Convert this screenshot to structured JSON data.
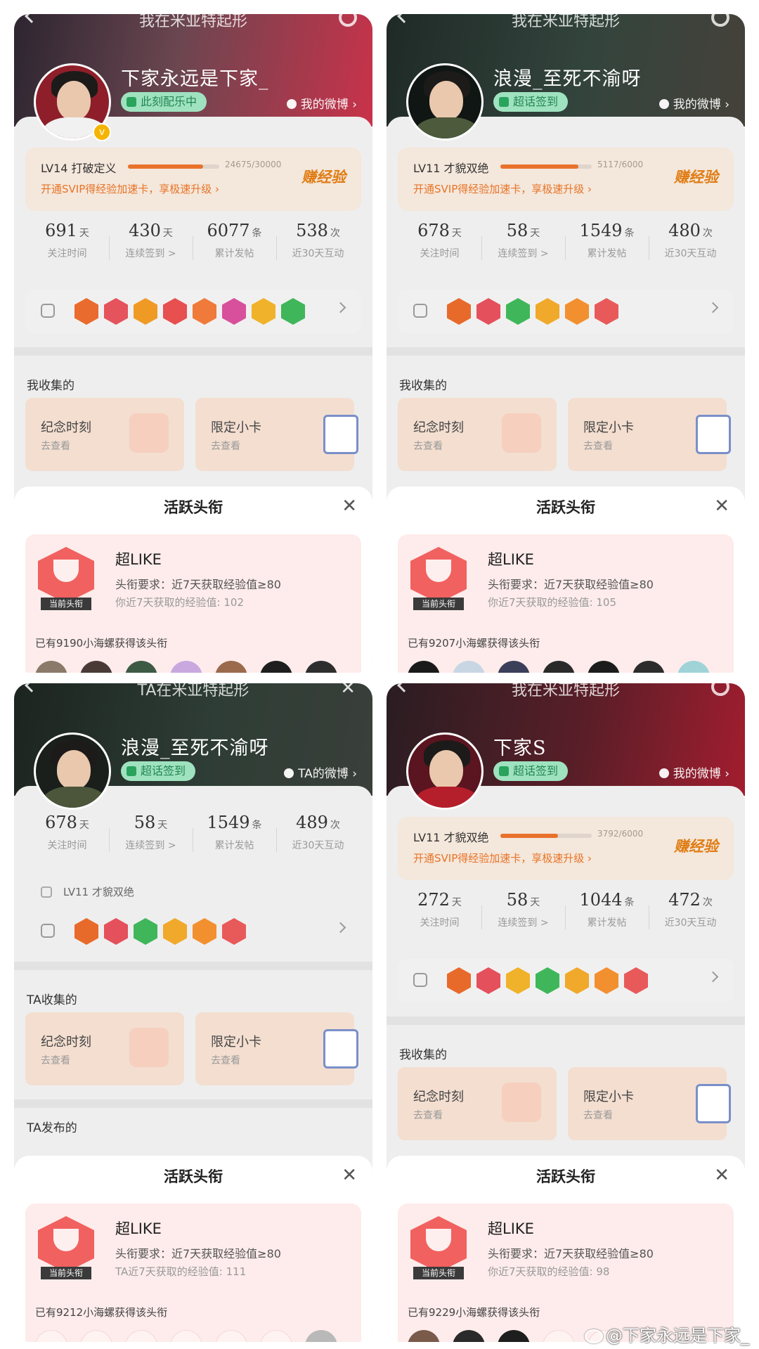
{
  "panels": [
    {
      "top_title": "我在米亚特起形",
      "nickname": "下家永远是下家_",
      "badge": "此刻配乐中",
      "weibo_link": "我的微博",
      "level": {
        "name": "LV14 打破定义",
        "progress_text": "24675/30000",
        "progress": 0.82,
        "promo": "开通SVIP得经验加速卡，享极速升级",
        "earn": "赚经验"
      },
      "stats": [
        {
          "num": "691",
          "unit": "天",
          "label": "关注时间"
        },
        {
          "num": "430",
          "unit": "天",
          "label": "连续签到 >"
        },
        {
          "num": "6077",
          "unit": "条",
          "label": "累计发帖"
        },
        {
          "num": "538",
          "unit": "次",
          "label": "近30天互动"
        }
      ],
      "collection_title": "我收集的",
      "tiles": [
        {
          "title": "纪念时刻",
          "sub": "去查看"
        },
        {
          "title": "限定小卡",
          "sub": "去查看"
        }
      ],
      "sheet": {
        "title": "活跃头衔",
        "name": "超LIKE",
        "requirement": "头衔要求：近7天获取经验值≥80",
        "exp": "你近7天获取的经验值: 102",
        "ribbon": "当前头衔",
        "count": "已有9190小海螺获得该头衔"
      }
    },
    {
      "top_title": "我在米亚特起形",
      "nickname": "浪漫_至死不渝呀",
      "badge": "超话签到",
      "weibo_link": "我的微博",
      "level": {
        "name": "LV11 才貌双绝",
        "progress_text": "5117/6000",
        "progress": 0.85,
        "promo": "开通SVIP得经验加速卡，享极速升级",
        "earn": "赚经验"
      },
      "stats": [
        {
          "num": "678",
          "unit": "天",
          "label": "关注时间"
        },
        {
          "num": "58",
          "unit": "天",
          "label": "连续签到 >"
        },
        {
          "num": "1549",
          "unit": "条",
          "label": "累计发帖"
        },
        {
          "num": "480",
          "unit": "次",
          "label": "近30天互动"
        }
      ],
      "collection_title": "我收集的",
      "tiles": [
        {
          "title": "纪念时刻",
          "sub": "去查看"
        },
        {
          "title": "限定小卡",
          "sub": "去查看"
        }
      ],
      "sheet": {
        "title": "活跃头衔",
        "name": "超LIKE",
        "requirement": "头衔要求：近7天获取经验值≥80",
        "exp": "你近7天获取的经验值: 105",
        "ribbon": "当前头衔",
        "count": "已有9207小海螺获得该头衔"
      }
    },
    {
      "top_title": "TA在米亚特起形",
      "nickname": "浪漫_至死不渝呀",
      "badge": "超话签到",
      "weibo_link": "TA的微博",
      "level_inline": "LV11 才貌双绝",
      "stats": [
        {
          "num": "678",
          "unit": "天",
          "label": "关注时间"
        },
        {
          "num": "58",
          "unit": "天",
          "label": "连续签到 >"
        },
        {
          "num": "1549",
          "unit": "条",
          "label": "累计发帖"
        },
        {
          "num": "489",
          "unit": "次",
          "label": "近30天互动"
        }
      ],
      "collection_title": "TA收集的",
      "published_title": "TA发布的",
      "tiles": [
        {
          "title": "纪念时刻",
          "sub": "去查看"
        },
        {
          "title": "限定小卡",
          "sub": "去查看"
        }
      ],
      "sheet": {
        "title": "活跃头衔",
        "name": "超LIKE",
        "requirement": "头衔要求：近7天获取经验值≥80",
        "exp": "TA近7天获取的经验值: 111",
        "ribbon": "当前头衔",
        "count": "已有9212小海螺获得该头衔"
      }
    },
    {
      "top_title": "我在米亚特起形",
      "nickname": "下家S",
      "badge": "超话签到",
      "weibo_link": "我的微博",
      "level": {
        "name": "LV11 才貌双绝",
        "progress_text": "3792/6000",
        "progress": 0.63,
        "promo": "开通SVIP得经验加速卡，享极速升级",
        "earn": "赚经验"
      },
      "stats": [
        {
          "num": "272",
          "unit": "天",
          "label": "关注时间"
        },
        {
          "num": "58",
          "unit": "天",
          "label": "连续签到 >"
        },
        {
          "num": "1044",
          "unit": "条",
          "label": "累计发帖"
        },
        {
          "num": "472",
          "unit": "次",
          "label": "近30天互动"
        }
      ],
      "collection_title": "我收集的",
      "tiles": [
        {
          "title": "纪念时刻",
          "sub": "去查看"
        },
        {
          "title": "限定小卡",
          "sub": "去查看"
        }
      ],
      "sheet": {
        "title": "活跃头衔",
        "name": "超LIKE",
        "requirement": "头衔要求：近7天获取经验值≥80",
        "exp": "你近7天获取的经验值: 98",
        "ribbon": "当前头衔",
        "count": "已有9229小海螺获得该头衔"
      }
    }
  ],
  "medal_colors": {
    "p1": [
      "#e96b2e",
      "#e5535d",
      "#f09a26",
      "#e84f4f",
      "#f07a3a",
      "#d8509c",
      "#f0b22a",
      "#3fb65a"
    ],
    "p2": [
      "#e86a2a",
      "#e4505b",
      "#3fb65a",
      "#f0a92a",
      "#f29030",
      "#e85a5a"
    ],
    "p3": [
      "#e86a2a",
      "#e4505b",
      "#3fb65a",
      "#f0a92a",
      "#f29030",
      "#e85a5a"
    ],
    "p4": [
      "#e86a2a",
      "#e4505b",
      "#f0b22a",
      "#3fb65a",
      "#f0a92a",
      "#f29030",
      "#e85a5a"
    ]
  },
  "mini_avatar_colors": {
    "p1": [
      "#8b7a6a",
      "#4a3a35",
      "#3d5a45",
      "#c9a8e0",
      "#9b6a4d",
      "#1e1e1e",
      "#2e2e2e"
    ],
    "p2": [
      "#1a1a1a",
      "#c8d6e4",
      "#3b3f5a",
      "#2a2a2a",
      "#1c1c1c",
      "#2c2c2c",
      "#9fd3d8"
    ],
    "p3": [
      "empty",
      "empty",
      "empty",
      "empty",
      "empty",
      "empty",
      "#b9b9b9"
    ],
    "p4": [
      "#7a5a4a",
      "#2a2a2a",
      "#1e1e1e",
      "empty",
      "empty",
      "empty",
      "empty"
    ]
  },
  "watermark": "@下家永远是下家_"
}
